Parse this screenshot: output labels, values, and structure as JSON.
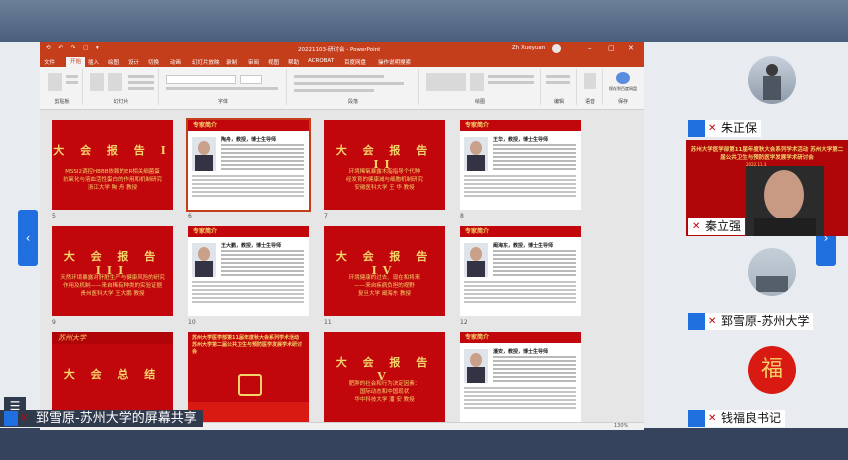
{
  "window": {
    "filename": "20221103-研讨会 - PowerPoint",
    "user": "Zh Xueyuan",
    "quick_access": "⟲ ↶ ↷ ▢ ▾"
  },
  "ribbon_tabs": [
    "文件",
    "开始",
    "插入",
    "绘图",
    "设计",
    "切换",
    "动画",
    "幻灯片放映",
    "录制",
    "审阅",
    "视图",
    "帮助",
    "ACROBAT",
    "百度网盘",
    "操作说明搜索"
  ],
  "ribbon_groups": {
    "clipboard": "剪贴板",
    "slides": "幻灯片",
    "font": "字体",
    "paragraph": "段落",
    "drawing": "绘图",
    "editing": "编辑",
    "voice": "语音",
    "save": "保存到百度网盘",
    "save_sub": "保存"
  },
  "slides": [
    {
      "num": "5",
      "kind": "report",
      "title": "大 会 报 告 I",
      "body": [
        "MSSI2调控HBBB依赖的ER相关细菌蛋",
        "抗氧化与溶血活性蛋白的作用和机制研究",
        "浙江大学  陶 舟  教授"
      ]
    },
    {
      "num": "6",
      "kind": "expert",
      "header": "专家简介",
      "name": "陶舟，教授，博士生导师"
    },
    {
      "num": "7",
      "kind": "report",
      "title": "大 会 报 告 II",
      "body": [
        "环境稀氧暴露木脂指导个代种",
        "经发育的健康减与细胞机制研究",
        "安徽医科大学  王 华  教授"
      ]
    },
    {
      "num": "8",
      "kind": "expert",
      "header": "专家简介",
      "name": "王华，教授，博士生导师"
    },
    {
      "num": "9",
      "kind": "report",
      "title": "大 会 报 告 III",
      "body": [
        "天然环境暴露对肝脏生产与健康风险的研究",
        "作用及机制——来自稀有种类的实验证据",
        "贵州医科大学  王大鹏  教授"
      ]
    },
    {
      "num": "10",
      "kind": "expert",
      "header": "专家简介",
      "name": "王大鹏，教授，博士生导师"
    },
    {
      "num": "11",
      "kind": "report",
      "title": "大 会 报 告 IV",
      "body": [
        "环境健康的过去、现在和将来",
        "——来自疾病负担的视野",
        "复旦大学  阚海东  教授"
      ]
    },
    {
      "num": "12",
      "kind": "expert",
      "header": "专家简介",
      "name": "阚海东，教授，博士生导师"
    },
    {
      "num": "",
      "kind": "logo",
      "logo": "苏州大学"
    },
    {
      "num": "",
      "kind": "conference",
      "title": "苏州大学医学部第11届年度秋大会系列学术活动 苏州大学第二届公共卫生与预防医学发展学术研讨会"
    },
    {
      "num": "",
      "kind": "report",
      "title": "大 会 报 告 V",
      "body": [
        "肥胖的社会和行为决定因素：",
        "国际动态和中国现状",
        "华中科技大学  潘 安  教授"
      ]
    },
    {
      "num": "",
      "kind": "expert",
      "header": "专家简介",
      "name": "潘安，教授，博士生导师"
    }
  ],
  "final_slide": {
    "title": "大 会 总 结"
  },
  "status": {
    "zoom": "130%"
  },
  "participants": [
    {
      "name": "朱正保"
    },
    {
      "name": "秦立强",
      "banner": "苏州大学医学部第11届年度秋大会系列学术活动 苏州大学第二届公共卫生与预防医学发展学术研讨会",
      "banner_date": "2022.11.3"
    },
    {
      "name": "郅雪原-苏州大学"
    },
    {
      "name": "钱福良书记"
    }
  ],
  "share_label": "郅雪原-苏州大学的屏幕共享",
  "colors": {
    "ppt_accent": "#c43e1c",
    "slide_red": "#c1060c",
    "slide_gold": "#f4d36a",
    "zoom_blue": "#1f6fde"
  }
}
